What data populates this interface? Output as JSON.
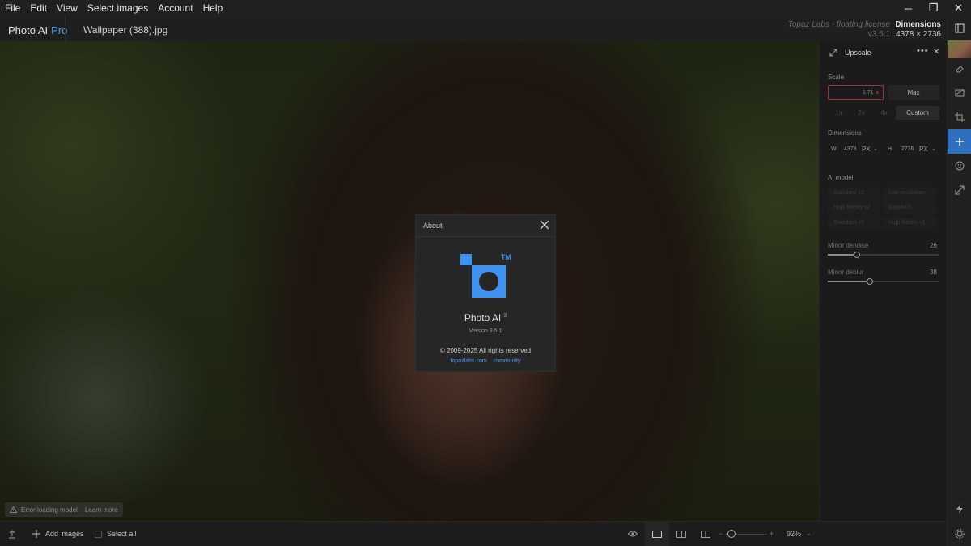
{
  "menu": [
    "File",
    "Edit",
    "View",
    "Select images",
    "Account",
    "Help"
  ],
  "window_controls": {
    "minimize": "─",
    "restore": "❐",
    "close": "✕"
  },
  "header": {
    "app_name": "Photo AI",
    "app_tier": "Pro",
    "file_name": "Wallpaper (388).jpg",
    "license_text": "Topaz Labs - floating license",
    "license_version": "v3.5.1",
    "dimensions_title": "Dimensions",
    "dimensions_value": "4378 × 2736"
  },
  "canvas": {
    "error_text": "Error loading model",
    "error_link": "Learn more"
  },
  "about": {
    "title": "About",
    "tm": "TM",
    "app_name": "Photo AI",
    "app_major": "3",
    "version": "Version 3.5.1",
    "copyright": "© 2009-2025 All rights reserved",
    "link_site": "topazlabs.com",
    "link_community": "community",
    "accent_color": "#3f93f0"
  },
  "panel": {
    "title": "Upscale",
    "scale_label": "Scale",
    "scale_value": "1.71",
    "scale_unit": "x",
    "max_label": "Max",
    "presets": [
      "1x",
      "2x",
      "4x"
    ],
    "custom_label": "Custom",
    "dimensions_label": "Dimensions",
    "width_prefix": "W",
    "width_value": "4378",
    "width_unit": "PX",
    "height_prefix": "H",
    "height_value": "2736",
    "height_unit": "PX",
    "ai_model_label": "AI model",
    "models": [
      "Standard v2",
      "Low resolution",
      "High fidelity v2",
      "Graphics",
      "Standard v1",
      "High fidelity v1"
    ],
    "denoise_label": "Minor denoise",
    "denoise_value": "26",
    "denoise_level": 0.26,
    "deblur_label": "Minor deblur",
    "deblur_value": "38",
    "deblur_level": 0.38
  },
  "bottombar": {
    "add_images": "Add images",
    "select_all": "Select all",
    "zoom": "92%"
  }
}
